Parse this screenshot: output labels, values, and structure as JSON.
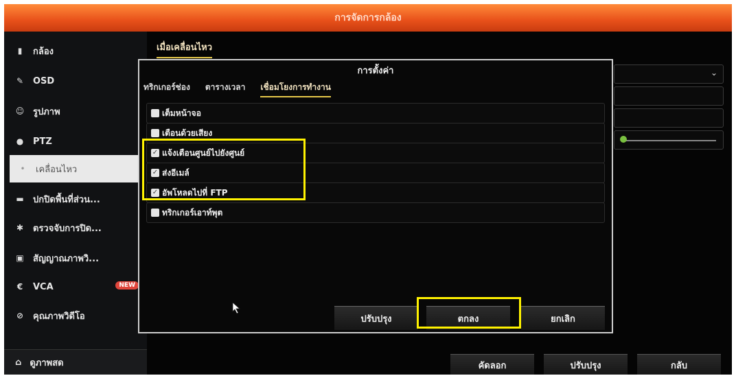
{
  "window": {
    "title": "การจัดการกล้อง"
  },
  "sidebar": {
    "items": [
      {
        "label": "กล้อง",
        "icon": "camera-icon"
      },
      {
        "label": "OSD",
        "icon": "osd-icon"
      },
      {
        "label": "รูปภาพ",
        "icon": "image-icon"
      },
      {
        "label": "PTZ",
        "icon": "ptz-icon"
      },
      {
        "label": "เคลื่อนไหว",
        "icon": "motion-icon",
        "active": true
      },
      {
        "label": "ปกปิดพื้นที่ส่วน...",
        "icon": "privacy-mask-icon"
      },
      {
        "label": "ตรวจจับการปิด...",
        "icon": "tamper-icon"
      },
      {
        "label": "สัญญาณภาพวิ...",
        "icon": "video-loss-icon"
      },
      {
        "label": "VCA",
        "icon": "vca-icon",
        "badge": "NEW"
      },
      {
        "label": "คุณภาพวิดีโอ",
        "icon": "video-quality-icon"
      }
    ],
    "live_view": "ดูภาพสด"
  },
  "main": {
    "tab": "เมื่อเคลื่อนไหว",
    "buttons": {
      "copy": "คัดลอก",
      "apply": "ปรับปรุง",
      "back": "กลับ"
    }
  },
  "dialog": {
    "title": "การตั้งค่า",
    "tabs": [
      "ทริกเกอร์ช่อง",
      "ตารางเวลา",
      "เชื่อมโยงการทำงาน"
    ],
    "active_tab": "เชื่อมโยงการทำงาน",
    "options": [
      {
        "label": "เต็มหน้าจอ",
        "checked": false
      },
      {
        "label": "เตือนด้วยเสียง",
        "checked": false
      },
      {
        "label": "แจ้งเตือนศูนย์ไปยังศูนย์",
        "checked": true
      },
      {
        "label": "ส่งอีเมล์",
        "checked": true
      },
      {
        "label": "อัพโหลดไปที่ FTP",
        "checked": true
      },
      {
        "label": "ทริกเกอร์เอาท์พุต",
        "checked": false
      }
    ],
    "buttons": {
      "apply": "ปรับปรุง",
      "ok": "ตกลง",
      "cancel": "ยกเลิก"
    }
  },
  "colors": {
    "title_bar": "#e8501a",
    "highlight": "#fff200",
    "active_tab_underline": "#e6c84a",
    "new_badge": "#e0463c"
  }
}
